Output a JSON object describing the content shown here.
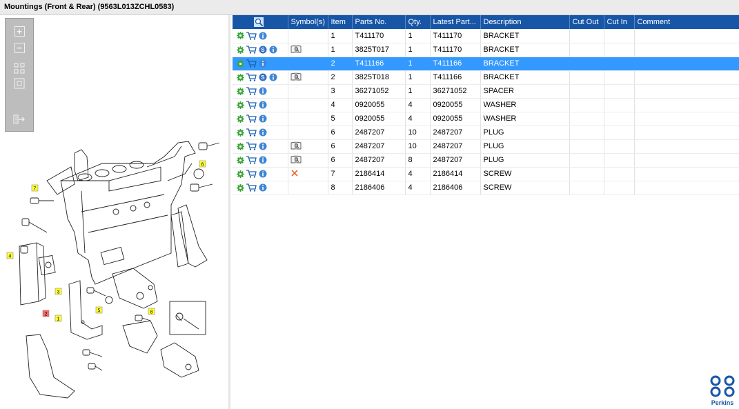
{
  "window": {
    "title": "Mountings (Front & Rear) (9563L013ZCHL0583)"
  },
  "toolbox": {
    "tools": [
      "zoom-in-icon",
      "zoom-out-icon",
      "fit-all-icon",
      "actual-size-icon",
      "export-icon"
    ]
  },
  "diagram": {
    "callouts": [
      "7",
      "6",
      "4",
      "3",
      "2",
      "1",
      "5",
      "8"
    ]
  },
  "table": {
    "columns": [
      "",
      "Symbol(s)",
      "Item",
      "Parts No.",
      "Qty.",
      "Latest Part...",
      "Description",
      "Cut Out",
      "Cut In",
      "Comment"
    ],
    "rows": [
      {
        "service": false,
        "symbol": "",
        "item": "1",
        "part": "T411170",
        "qty": "1",
        "latest": "T411170",
        "desc": "BRACKET",
        "cutout": "",
        "cutin": "",
        "comment": "",
        "selected": false
      },
      {
        "service": true,
        "symbol": "book",
        "item": "1",
        "part": "3825T017",
        "qty": "1",
        "latest": "T411170",
        "desc": "BRACKET",
        "cutout": "",
        "cutin": "",
        "comment": "",
        "selected": false
      },
      {
        "service": false,
        "symbol": "",
        "item": "2",
        "part": "T411166",
        "qty": "1",
        "latest": "T411166",
        "desc": "BRACKET",
        "cutout": "",
        "cutin": "",
        "comment": "",
        "selected": true
      },
      {
        "service": true,
        "symbol": "book",
        "item": "2",
        "part": "3825T018",
        "qty": "1",
        "latest": "T411166",
        "desc": "BRACKET",
        "cutout": "",
        "cutin": "",
        "comment": "",
        "selected": false
      },
      {
        "service": false,
        "symbol": "",
        "item": "3",
        "part": "36271052",
        "qty": "1",
        "latest": "36271052",
        "desc": "SPACER",
        "cutout": "",
        "cutin": "",
        "comment": "",
        "selected": false
      },
      {
        "service": false,
        "symbol": "",
        "item": "4",
        "part": "0920055",
        "qty": "4",
        "latest": "0920055",
        "desc": "WASHER",
        "cutout": "",
        "cutin": "",
        "comment": "",
        "selected": false
      },
      {
        "service": false,
        "symbol": "",
        "item": "5",
        "part": "0920055",
        "qty": "4",
        "latest": "0920055",
        "desc": "WASHER",
        "cutout": "",
        "cutin": "",
        "comment": "",
        "selected": false
      },
      {
        "service": false,
        "symbol": "",
        "item": "6",
        "part": "2487207",
        "qty": "10",
        "latest": "2487207",
        "desc": "PLUG",
        "cutout": "",
        "cutin": "",
        "comment": "",
        "selected": false
      },
      {
        "service": false,
        "symbol": "book",
        "item": "6",
        "part": "2487207",
        "qty": "10",
        "latest": "2487207",
        "desc": "PLUG",
        "cutout": "",
        "cutin": "",
        "comment": "",
        "selected": false
      },
      {
        "service": false,
        "symbol": "book",
        "item": "6",
        "part": "2487207",
        "qty": "8",
        "latest": "2487207",
        "desc": "PLUG",
        "cutout": "",
        "cutin": "",
        "comment": "",
        "selected": false
      },
      {
        "service": false,
        "symbol": "cross",
        "item": "7",
        "part": "2186414",
        "qty": "4",
        "latest": "2186414",
        "desc": "SCREW",
        "cutout": "",
        "cutin": "",
        "comment": "",
        "selected": false
      },
      {
        "service": false,
        "symbol": "",
        "item": "8",
        "part": "2186406",
        "qty": "4",
        "latest": "2186406",
        "desc": "SCREW",
        "cutout": "",
        "cutin": "",
        "comment": "",
        "selected": false
      }
    ]
  },
  "brand": {
    "name": "Perkins",
    "color": "#1756a6"
  },
  "colors": {
    "header": "#1756a6",
    "selected": "#3399ff",
    "callout": "#ffff33",
    "callout_active": "#ff6666"
  }
}
